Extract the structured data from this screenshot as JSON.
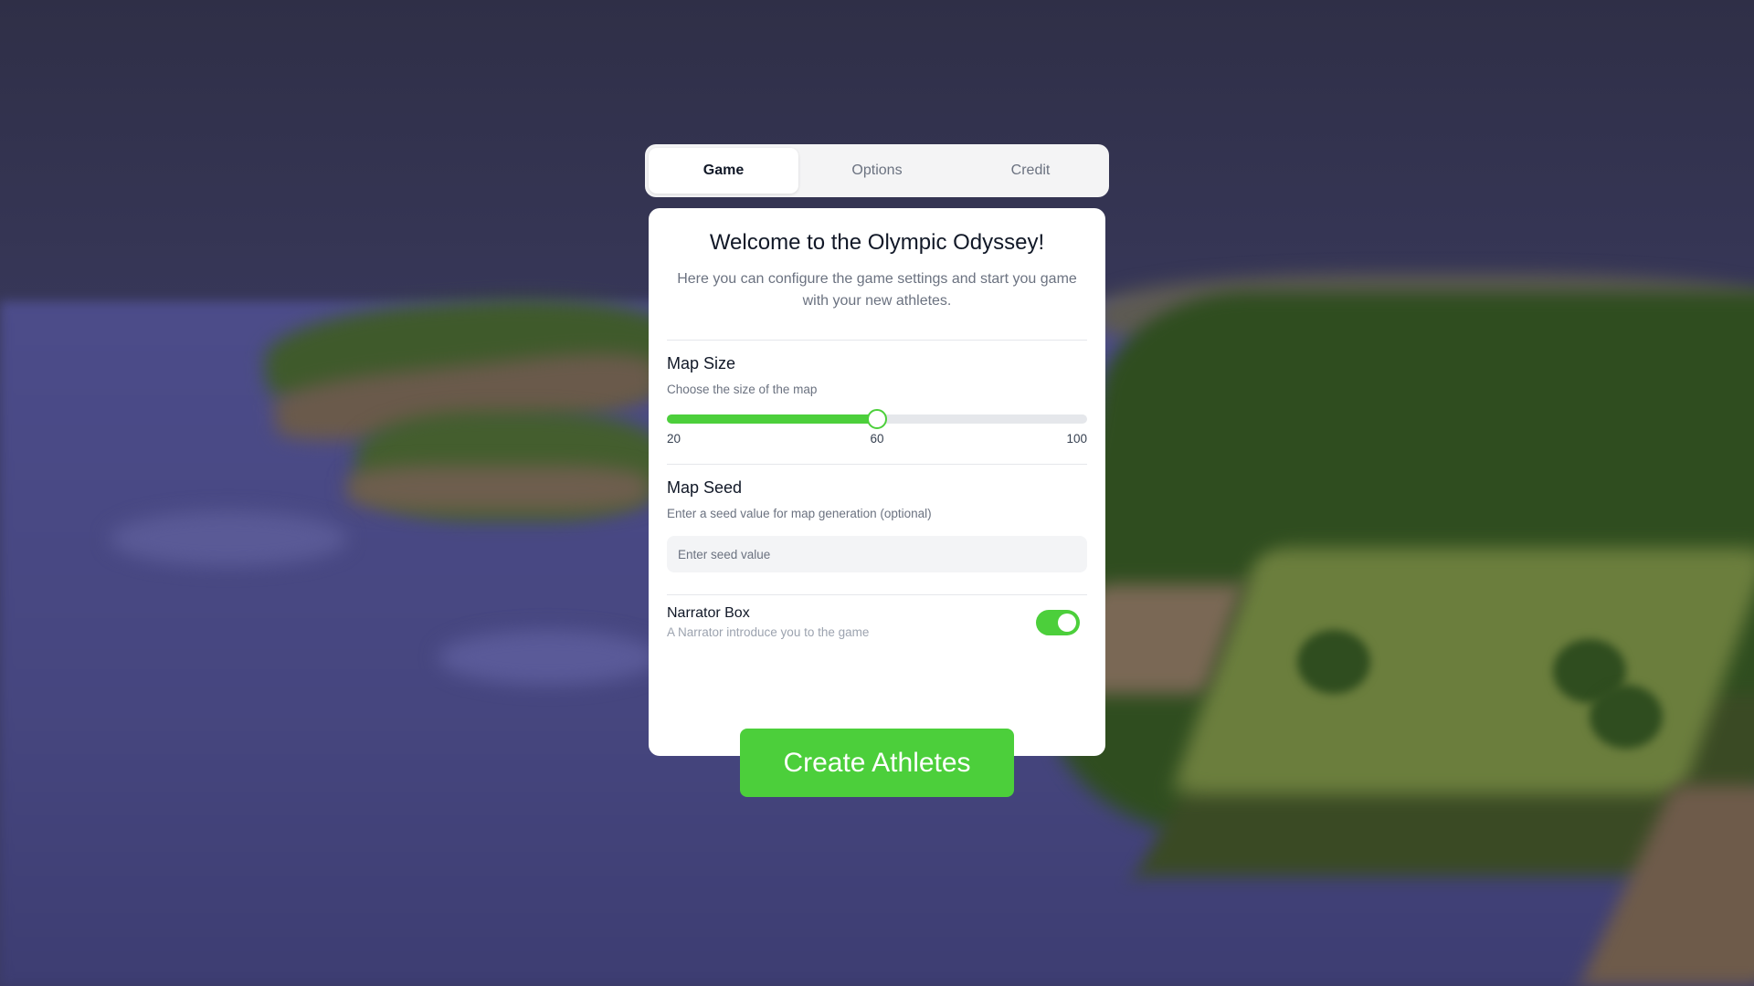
{
  "tabs": [
    {
      "label": "Game",
      "active": true
    },
    {
      "label": "Options",
      "active": false
    },
    {
      "label": "Credit",
      "active": false
    }
  ],
  "card": {
    "title": "Welcome to the Olympic Odyssey!",
    "subtitle": "Here you can configure the game settings and start you game with your new athletes."
  },
  "map_size": {
    "title": "Map Size",
    "description": "Choose the size of the map",
    "min": 20,
    "max": 100,
    "value": 60,
    "min_label": "20",
    "value_label": "60",
    "max_label": "100"
  },
  "map_seed": {
    "title": "Map Seed",
    "description": "Enter a seed value for map generation (optional)",
    "placeholder": "Enter seed value",
    "value": ""
  },
  "narrator": {
    "title": "Narrator Box",
    "description": "A Narrator introduce you to the game",
    "enabled": true
  },
  "create_button": {
    "label": "Create Athletes"
  },
  "colors": {
    "accent": "#4ccf3b",
    "card_bg": "#ffffff",
    "tab_bg": "#f4f4f5"
  }
}
